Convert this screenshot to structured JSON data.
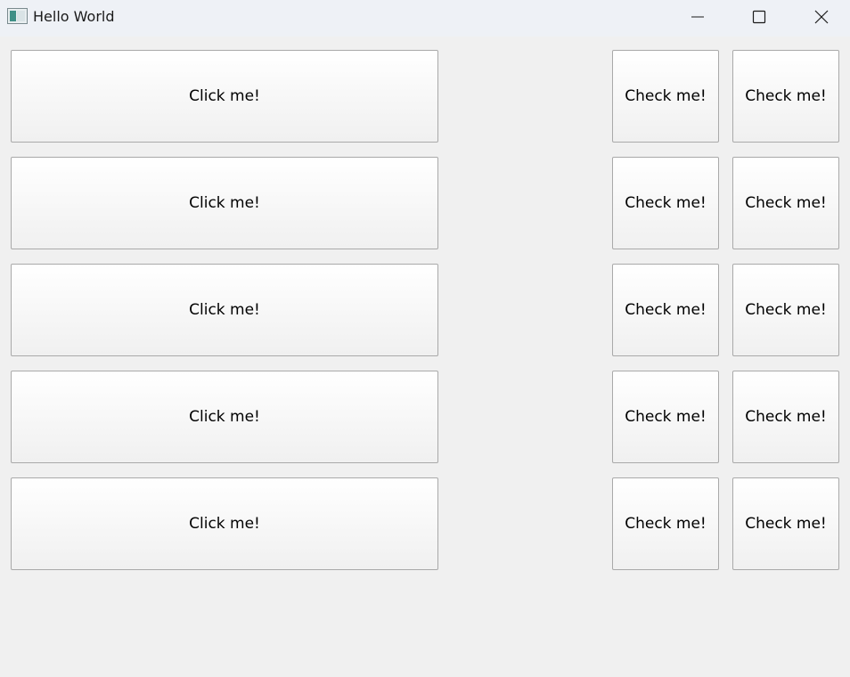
{
  "window": {
    "title": "Hello World"
  },
  "titlebar_controls": {
    "minimize": "minimize-icon",
    "maximize": "maximize-icon",
    "close": "close-icon"
  },
  "rows": [
    {
      "click_label": "Click me!",
      "check_a_label": "Check me!",
      "check_b_label": "Check me!"
    },
    {
      "click_label": "Click me!",
      "check_a_label": "Check me!",
      "check_b_label": "Check me!"
    },
    {
      "click_label": "Click me!",
      "check_a_label": "Check me!",
      "check_b_label": "Check me!"
    },
    {
      "click_label": "Click me!",
      "check_a_label": "Check me!",
      "check_b_label": "Check me!"
    },
    {
      "click_label": "Click me!",
      "check_a_label": "Check me!",
      "check_b_label": "Check me!"
    }
  ]
}
